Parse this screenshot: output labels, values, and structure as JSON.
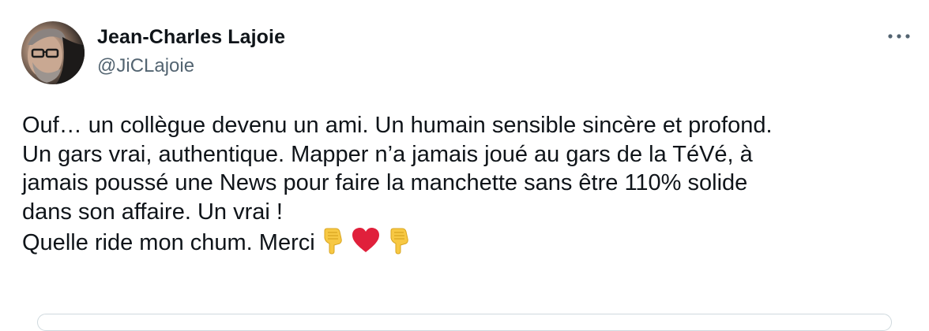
{
  "tweet": {
    "author": {
      "display_name": "Jean-Charles Lajoie",
      "handle": "@JiCLajoie"
    },
    "more_icon": "more-horizontal-icon",
    "text_lines": [
      "Ouf… un collègue devenu un ami. Un humain sensible sincère et profond.",
      "Un gars vrai, authentique. Mapper n’a jamais joué au gars de la TéVé, à",
      "jamais poussé une News pour faire la manchette sans être 110% solide",
      "dans son affaire. Un vrai !",
      "Quelle ride mon chum. Merci"
    ],
    "emojis": [
      "pointing-down-hand-icon",
      "red-heart-icon",
      "pointing-down-hand-icon"
    ],
    "colors": {
      "text": "#0f1419",
      "secondary_text": "#536471",
      "heart": "#e0203b",
      "hand": "#f7c843",
      "card_border": "#cfd9de"
    }
  }
}
